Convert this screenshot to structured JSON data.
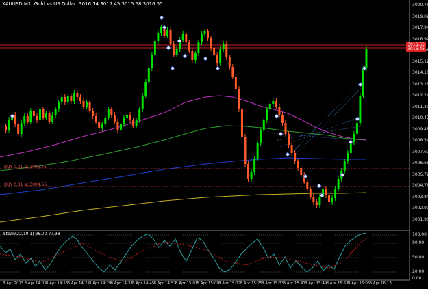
{
  "header": {
    "symbol_tf": "XAUUSD,M1",
    "description": "Gold vs US Dollar",
    "ohlc": "3016.14 3017.45 3015.68 3016.55"
  },
  "price_axis": {
    "ticks": [
      "3020.76",
      "3019.02",
      "3017.94",
      "3016.92",
      "3016.06",
      "3015.12",
      "3014.10",
      "3013.18",
      "3012.24",
      "3011.30",
      "3010.42",
      "3009.48",
      "3008.54",
      "3007.60",
      "3006.66",
      "3005.72",
      "3004.78",
      "3003.84",
      "3002.90",
      "3001.96"
    ],
    "current_prices": [
      "3016.55",
      "3016.45"
    ]
  },
  "time_axis": {
    "labels": [
      "8 Apr 2025",
      "8 Apr 14:05",
      "8 Apr 14:13",
      "8 Apr 14:21",
      "8 Apr 14:29",
      "8 Apr 14:37",
      "8 Apr 14:45",
      "8 Apr 14:53",
      "8 Apr 15:01",
      "8 Apr 15:09",
      "8 Apr 15:17",
      "8 Apr 15:25",
      "8 Apr 15:33",
      "8 Apr 15:41",
      "8 Apr 15:49",
      "8 Apr 15:57",
      "8 Apr 16:05",
      "8 Apr 16:13"
    ]
  },
  "orders": {
    "buy1": "BUY 0.01 at 3005.75",
    "buy2": "BUY 0.01 at 3004.66"
  },
  "stoch": {
    "label": "Stoch(22,10,1) 96.70 77.38",
    "levels": [
      "100.00",
      "80.00",
      "50.00",
      "20.00",
      "0.00"
    ]
  },
  "colors": {
    "bull": "#00e000",
    "bear": "#ff5a2a",
    "ma_magenta": "#c030c0",
    "ma_green": "#30a030",
    "ma_blue": "#2040d0",
    "ma_yellow": "#c8b020",
    "grid": "#2a2a2a"
  }
}
